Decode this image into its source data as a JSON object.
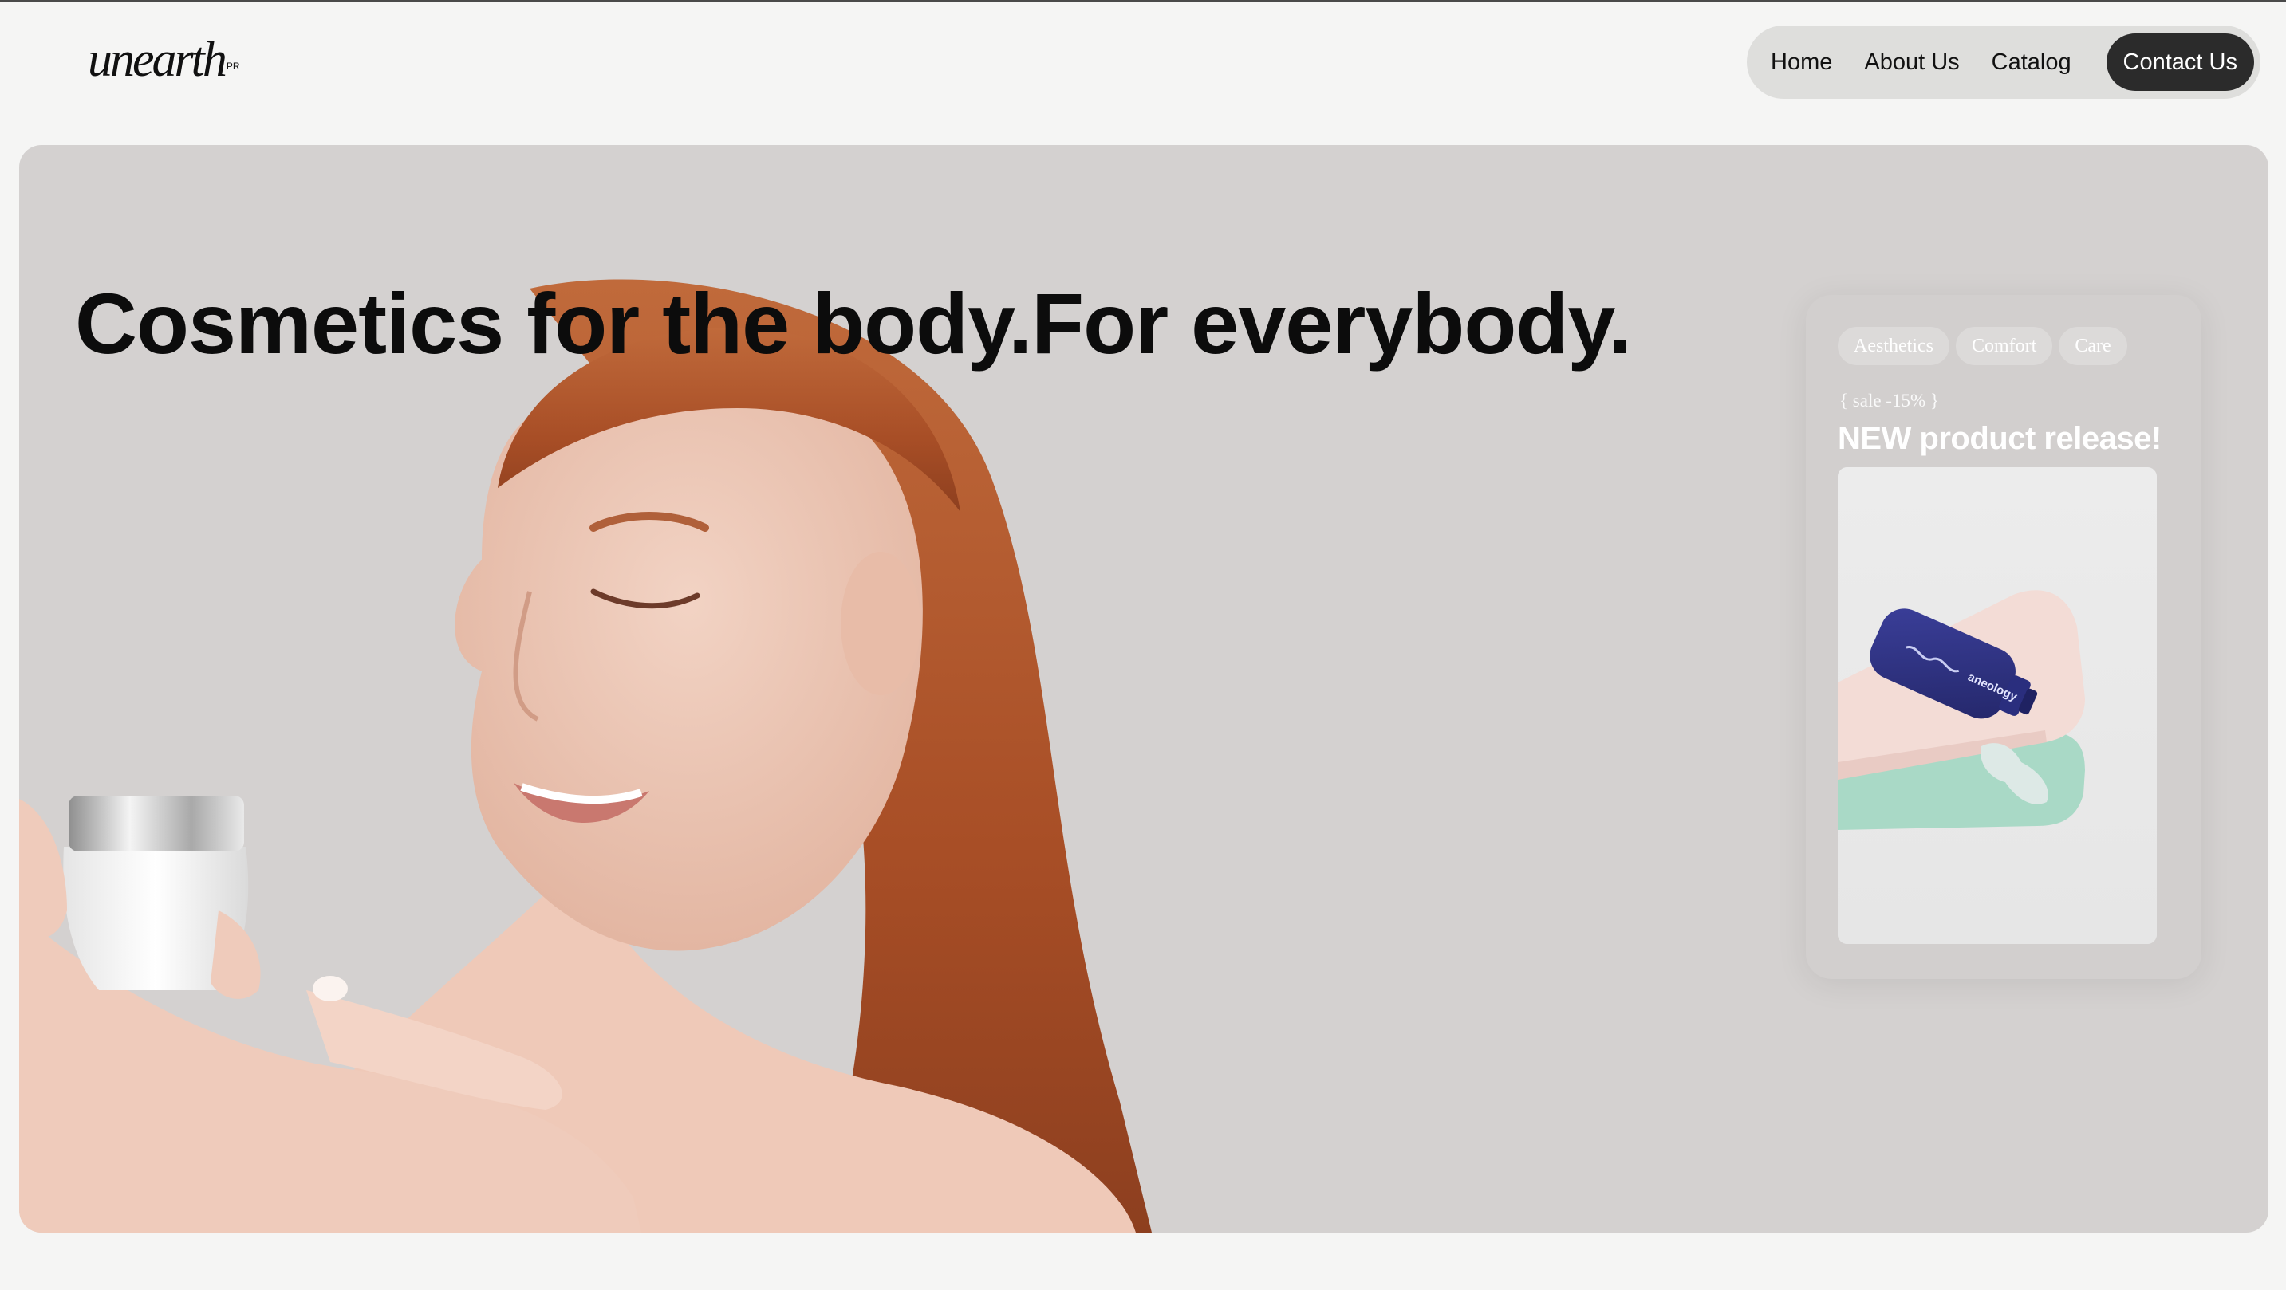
{
  "brand": {
    "logo_text": "unearth",
    "logo_mark": "PR"
  },
  "nav": {
    "items": [
      {
        "label": "Home"
      },
      {
        "label": "About Us"
      },
      {
        "label": "Catalog"
      }
    ],
    "cta_label": "Contact Us"
  },
  "hero": {
    "headline_light": "Cosmetics for the body.",
    "headline_bold": "For everybody."
  },
  "promo": {
    "tags": [
      "Aesthetics",
      "Comfort",
      "Care"
    ],
    "sale_text": "{ sale -15% }",
    "title": "NEW product release!",
    "bottle_label": "aneology"
  },
  "colors": {
    "page_bg": "#f5f5f4",
    "hero_bg": "#d4d1d0",
    "nav_bg": "#dededc",
    "cta_bg": "#2b2b2b",
    "bottle": "#2c2f7a"
  }
}
